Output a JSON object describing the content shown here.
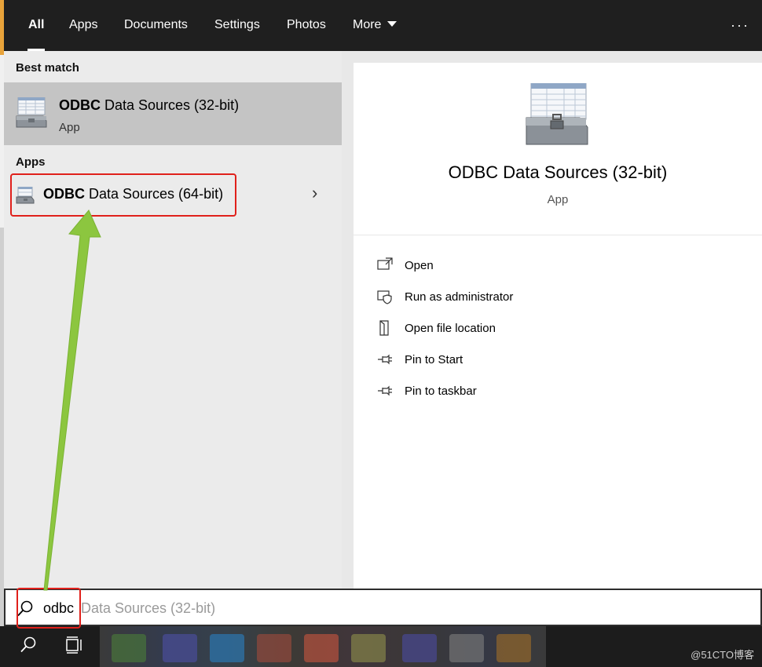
{
  "tabs": [
    {
      "label": "All",
      "active": true
    },
    {
      "label": "Apps",
      "active": false
    },
    {
      "label": "Documents",
      "active": false
    },
    {
      "label": "Settings",
      "active": false
    },
    {
      "label": "Photos",
      "active": false
    },
    {
      "label": "More",
      "active": false
    }
  ],
  "more_menu_icon": "ellipsis-icon",
  "results": {
    "best_match_heading": "Best match",
    "best_match": {
      "title_bold": "ODBC",
      "title_rest": " Data Sources (32-bit)",
      "subtitle": "App",
      "icon": "odbc-toolbox-icon"
    },
    "apps_heading": "Apps",
    "apps": [
      {
        "title_bold": "ODBC",
        "title_rest": " Data Sources (64-bit)",
        "icon": "odbc-toolbox-icon",
        "chevron": "›"
      }
    ]
  },
  "detail": {
    "title": "ODBC Data Sources (32-bit)",
    "subtitle": "App",
    "actions": [
      {
        "label": "Open",
        "icon": "open-window-icon"
      },
      {
        "label": "Run as administrator",
        "icon": "shield-admin-icon"
      },
      {
        "label": "Open file location",
        "icon": "file-location-icon"
      },
      {
        "label": "Pin to Start",
        "icon": "pin-icon"
      },
      {
        "label": "Pin to taskbar",
        "icon": "pin-icon"
      }
    ]
  },
  "search": {
    "typed": "odbc",
    "suggestion": " Data Sources (32-bit)"
  },
  "taskbar": {
    "watermark": "@51CTO博客"
  },
  "colors": {
    "top_bar": "#1f1f1f",
    "selected_result": "#c4c4c4",
    "annotation_red": "#e0201b",
    "annotation_arrow": "#8cc63f"
  }
}
